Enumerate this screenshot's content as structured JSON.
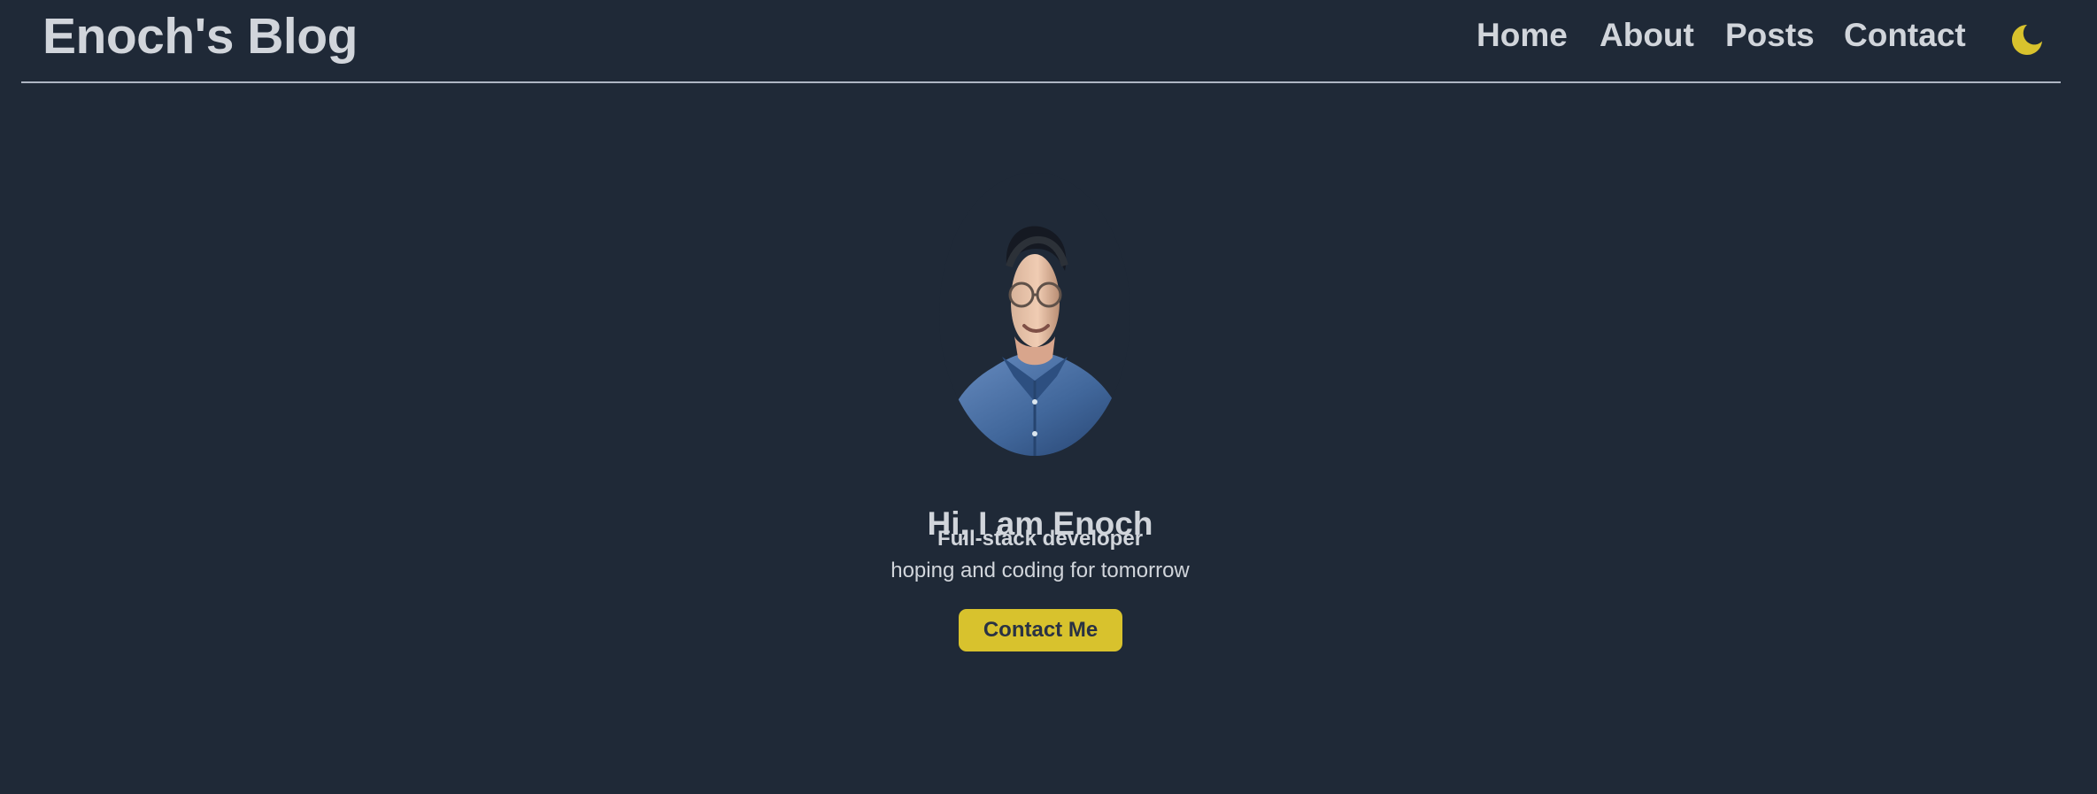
{
  "site": {
    "title": "Enoch's Blog"
  },
  "nav": {
    "items": [
      {
        "label": "Home"
      },
      {
        "label": "About"
      },
      {
        "label": "Posts"
      },
      {
        "label": "Contact"
      }
    ],
    "theme_toggle_icon": "moon-icon"
  },
  "hero": {
    "title": "Hi, I am Enoch",
    "subtitle": "Full-stack developer",
    "tagline": "hoping and coding for tomorrow",
    "button_label": "Contact Me",
    "avatar_alt": "Profile photo"
  },
  "colors": {
    "background": "#1f2937",
    "text": "#d1d5db",
    "accent": "#d8c22d"
  }
}
